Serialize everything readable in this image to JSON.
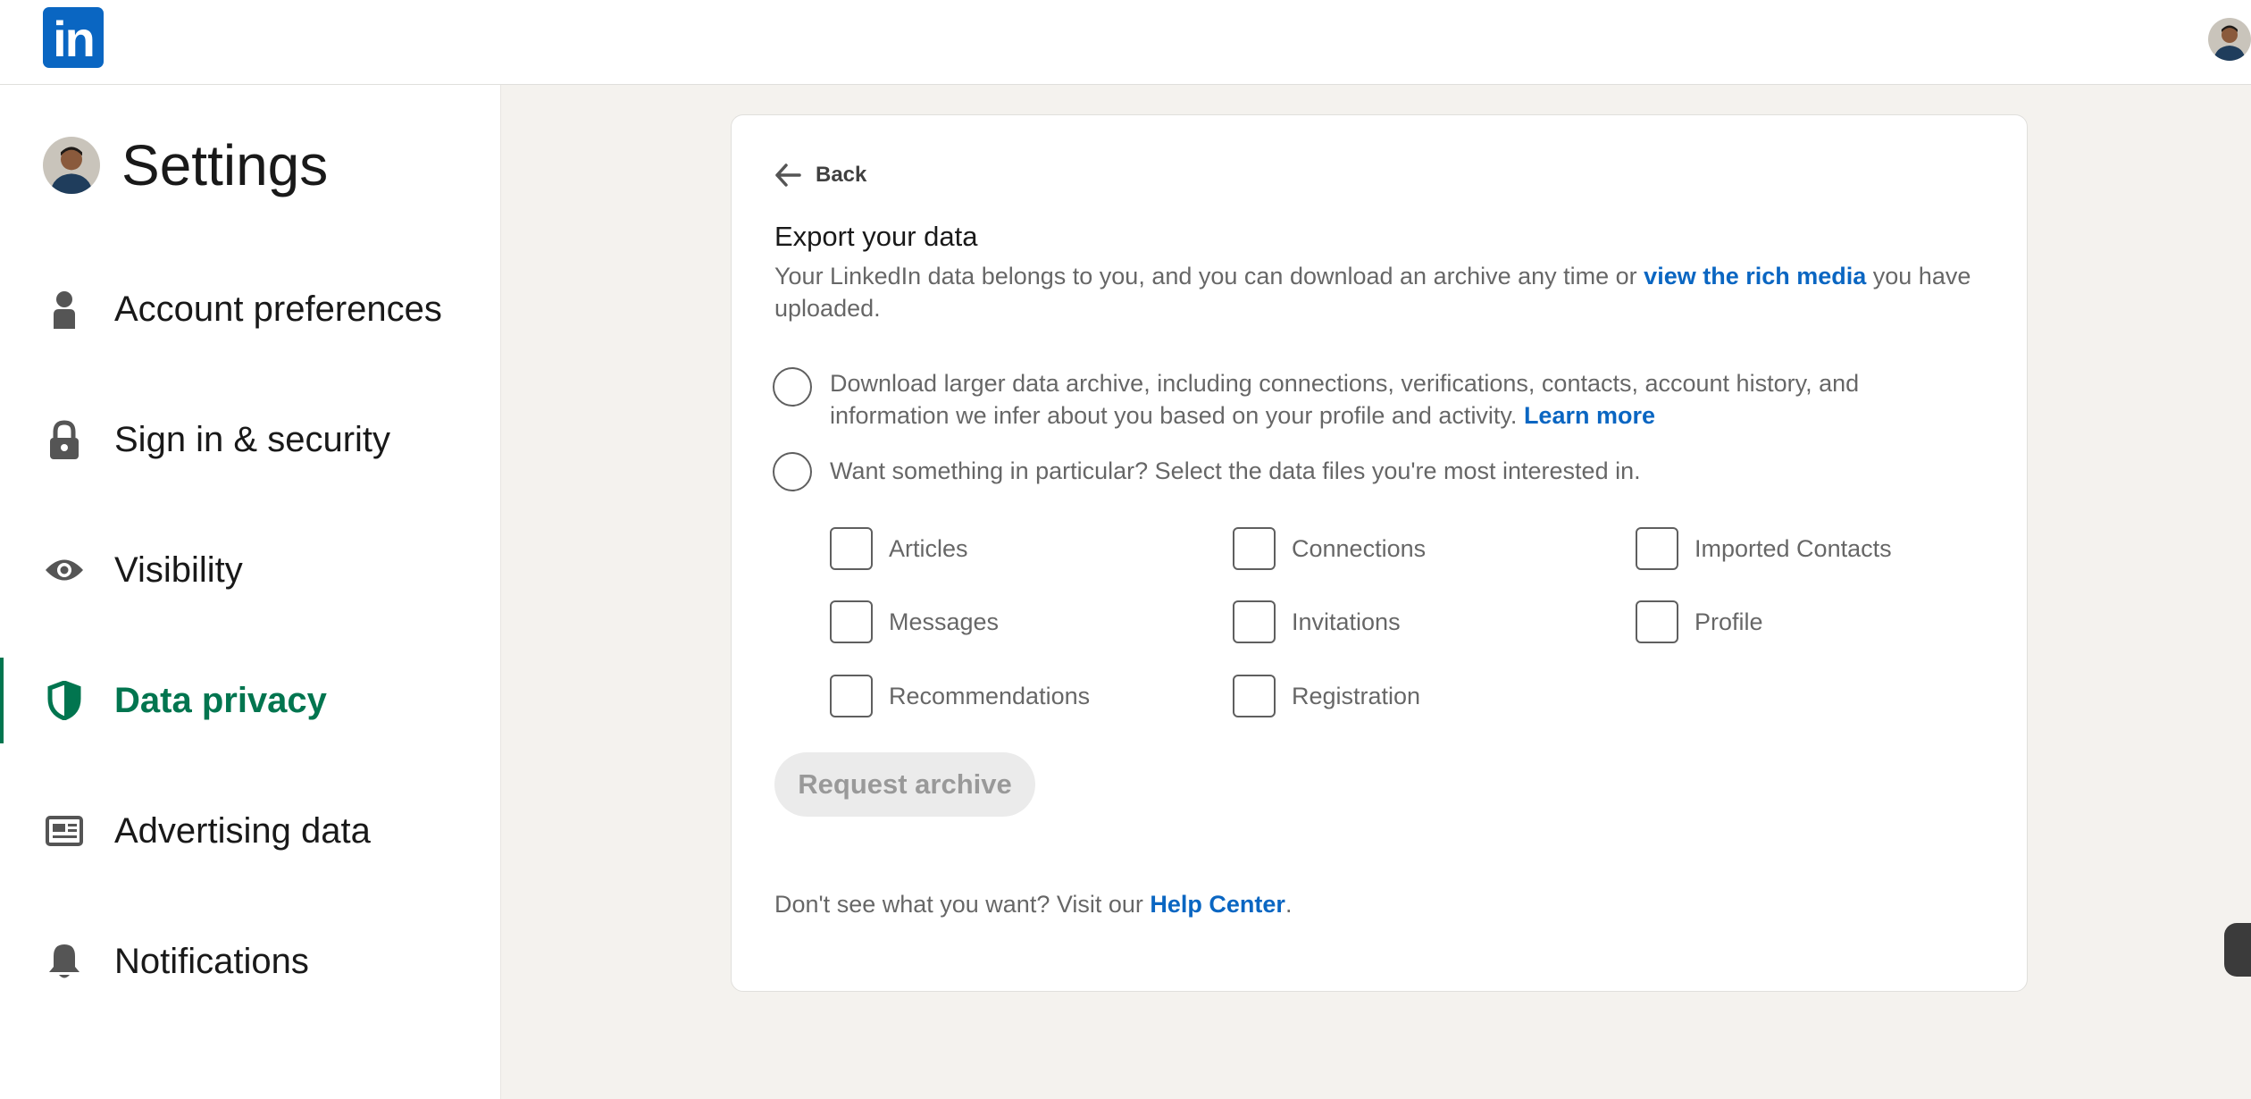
{
  "header": {
    "logo_text": "in",
    "logo_color": "#0a66c2",
    "avatar_icon": "profile-photo"
  },
  "sidebar": {
    "title": "Settings",
    "items": [
      {
        "label": "Account preferences",
        "icon": "person-icon",
        "active": false
      },
      {
        "label": "Sign in & security",
        "icon": "lock-icon",
        "active": false
      },
      {
        "label": "Visibility",
        "icon": "eye-icon",
        "active": false
      },
      {
        "label": "Data privacy",
        "icon": "shield-icon",
        "active": true
      },
      {
        "label": "Advertising data",
        "icon": "newspaper-icon",
        "active": false
      },
      {
        "label": "Notifications",
        "icon": "bell-icon",
        "active": false
      }
    ],
    "active_color": "#01754f"
  },
  "main": {
    "back_label": "Back",
    "title": "Export your data",
    "intro_before": "Your LinkedIn data belongs to you, and you can download an archive any time or ",
    "intro_link": "view the rich media",
    "intro_after": " you have uploaded.",
    "option1_text": "Download larger data archive, including connections, verifications, contacts, account history, and information we infer about you based on your profile and activity. ",
    "option1_link": "Learn more",
    "option2_text": "Want something in particular? Select the data files you're most interested in.",
    "files": [
      "Articles",
      "Connections",
      "Imported Contacts",
      "Messages",
      "Invitations",
      "Profile",
      "Recommendations",
      "Registration"
    ],
    "request_button": "Request archive",
    "footer_before": "Don't see what you want? Visit our ",
    "footer_link": "Help Center",
    "footer_after": ".",
    "link_color": "#0a66c2"
  }
}
